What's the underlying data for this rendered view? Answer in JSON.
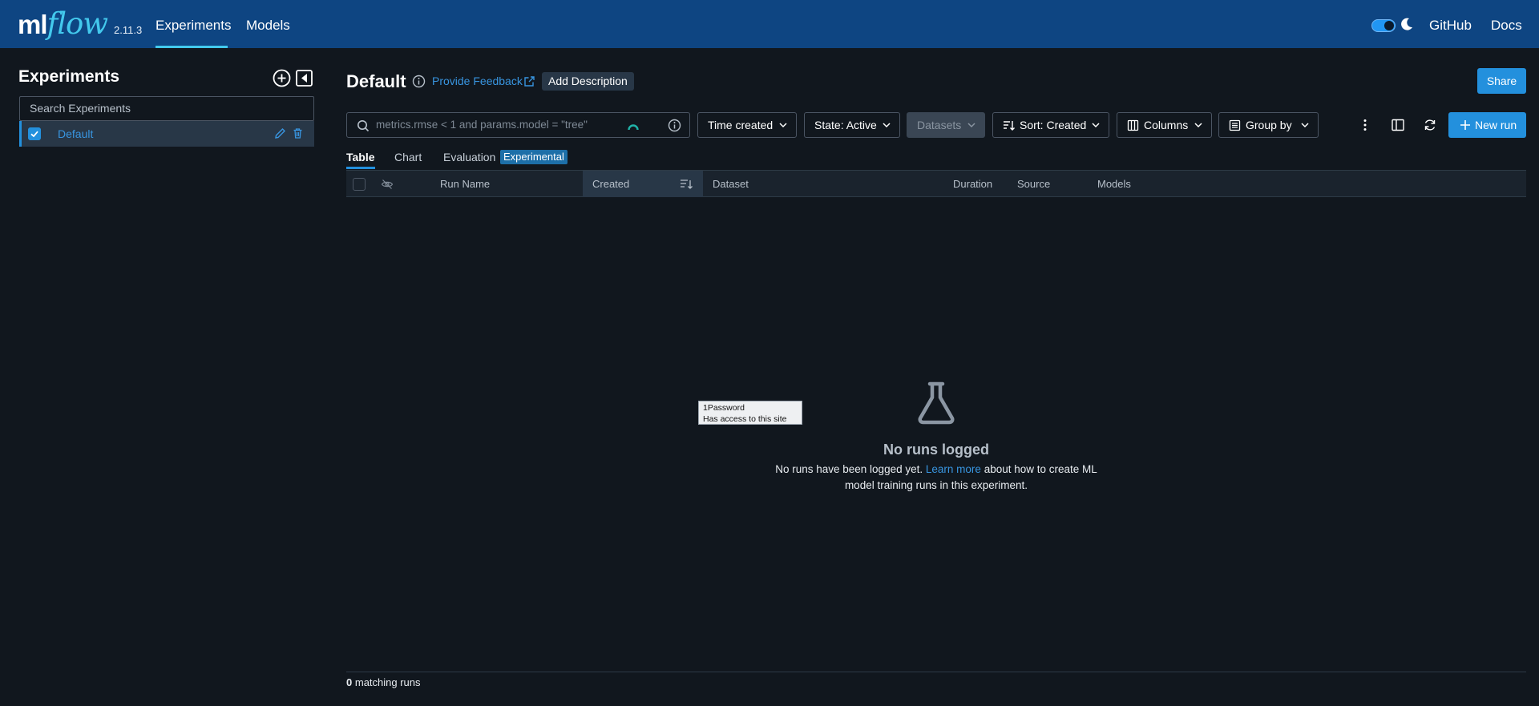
{
  "header": {
    "logo_ml": "ml",
    "logo_flow": "flow",
    "version": "2.11.3",
    "nav": [
      {
        "label": "Experiments",
        "active": true
      },
      {
        "label": "Models",
        "active": false
      }
    ],
    "links": {
      "github": "GitHub",
      "docs": "Docs"
    },
    "theme": "dark"
  },
  "sidebar": {
    "title": "Experiments",
    "search_placeholder": "Search Experiments",
    "experiments": [
      {
        "name": "Default",
        "checked": true
      }
    ]
  },
  "main": {
    "title": "Default",
    "feedback_label": "Provide Feedback",
    "add_description_label": "Add Description",
    "share_label": "Share",
    "search_placeholder": "metrics.rmse < 1 and params.model = \"tree\"",
    "filters": {
      "time_created": "Time created",
      "state": "State: Active",
      "datasets": "Datasets",
      "sort": "Sort: Created",
      "columns": "Columns",
      "group_by": "Group by"
    },
    "new_run_label": "New run",
    "tabs": [
      {
        "label": "Table",
        "active": true
      },
      {
        "label": "Chart",
        "active": false
      },
      {
        "label": "Evaluation",
        "active": false
      }
    ],
    "experimental_badge": "Experimental",
    "columns": [
      "Run Name",
      "Created",
      "Dataset",
      "Duration",
      "Source",
      "Models"
    ],
    "empty_state": {
      "title": "No runs logged",
      "text_before": "No runs have been logged yet.",
      "link": "Learn more",
      "text_after": "about how to create ML model training runs in this experiment."
    },
    "footer": {
      "count": "0",
      "label": "matching runs"
    }
  },
  "tooltip": {
    "line1": "1Password",
    "line2": "Has access to this site"
  },
  "colors": {
    "header_bg": "#0e4582",
    "accent": "#2390dd",
    "link": "#3895e0",
    "page_bg": "#11171e",
    "logo_flow": "#43c9ed"
  }
}
